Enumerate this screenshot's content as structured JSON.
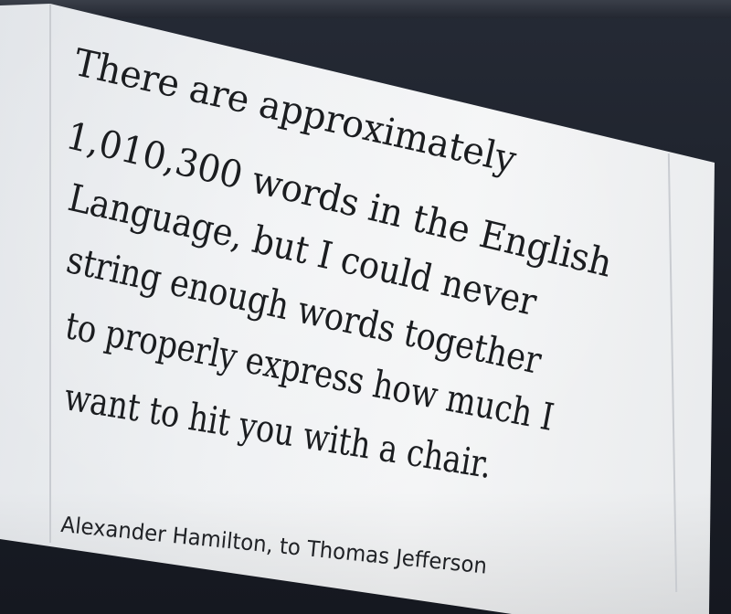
{
  "quote": {
    "lines": [
      "There are approximately",
      "1,010,300 words in the English",
      "Language, but I could never",
      "string enough words together",
      "to properly express how much I",
      "want to hit you with a chair."
    ]
  },
  "attribution": "Alexander Hamilton, to Thomas Jefferson"
}
